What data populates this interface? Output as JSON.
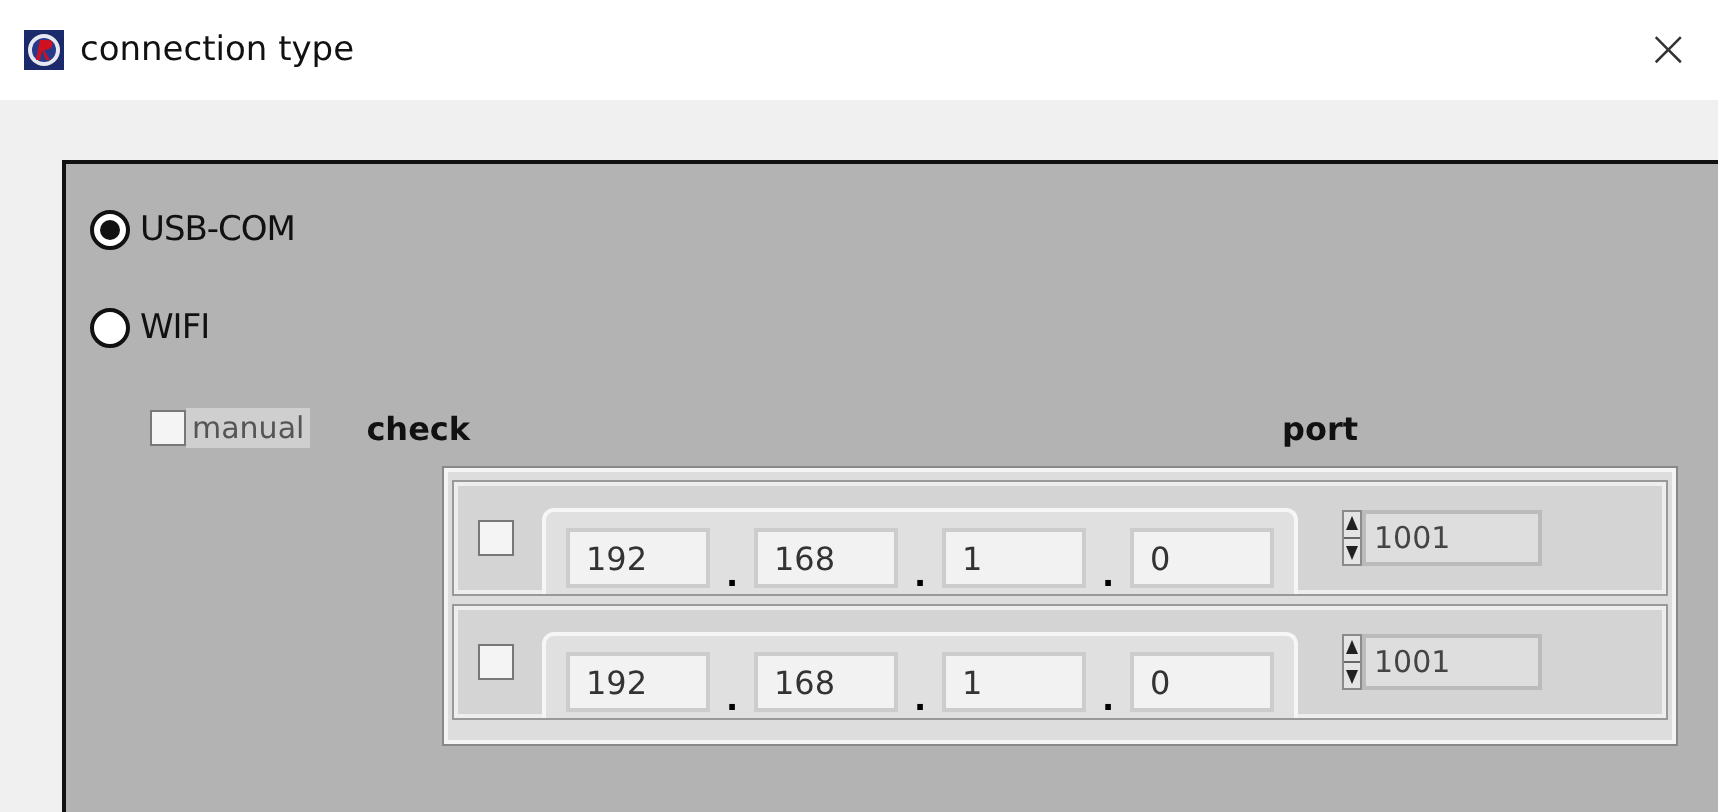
{
  "window": {
    "title": "connection type",
    "close": "×"
  },
  "connection": [
    {
      "label": "USB-COM",
      "selected": true
    },
    {
      "label": "WIFI",
      "selected": false
    }
  ],
  "manual": {
    "label": "manual",
    "checked": false
  },
  "table": {
    "columns": [
      "check",
      "port"
    ],
    "rows": [
      {
        "checked": false,
        "octets": [
          {
            "value": "192",
            "dot": "."
          },
          {
            "value": "168",
            "dot": "."
          },
          {
            "value": "1",
            "dot": "."
          },
          {
            "value": "0"
          }
        ],
        "port": "1001"
      },
      {
        "checked": false,
        "octets": [
          {
            "value": "192",
            "dot": "."
          },
          {
            "value": "168",
            "dot": "."
          },
          {
            "value": "1",
            "dot": "."
          },
          {
            "value": "0"
          }
        ],
        "port": "1001"
      }
    ]
  }
}
